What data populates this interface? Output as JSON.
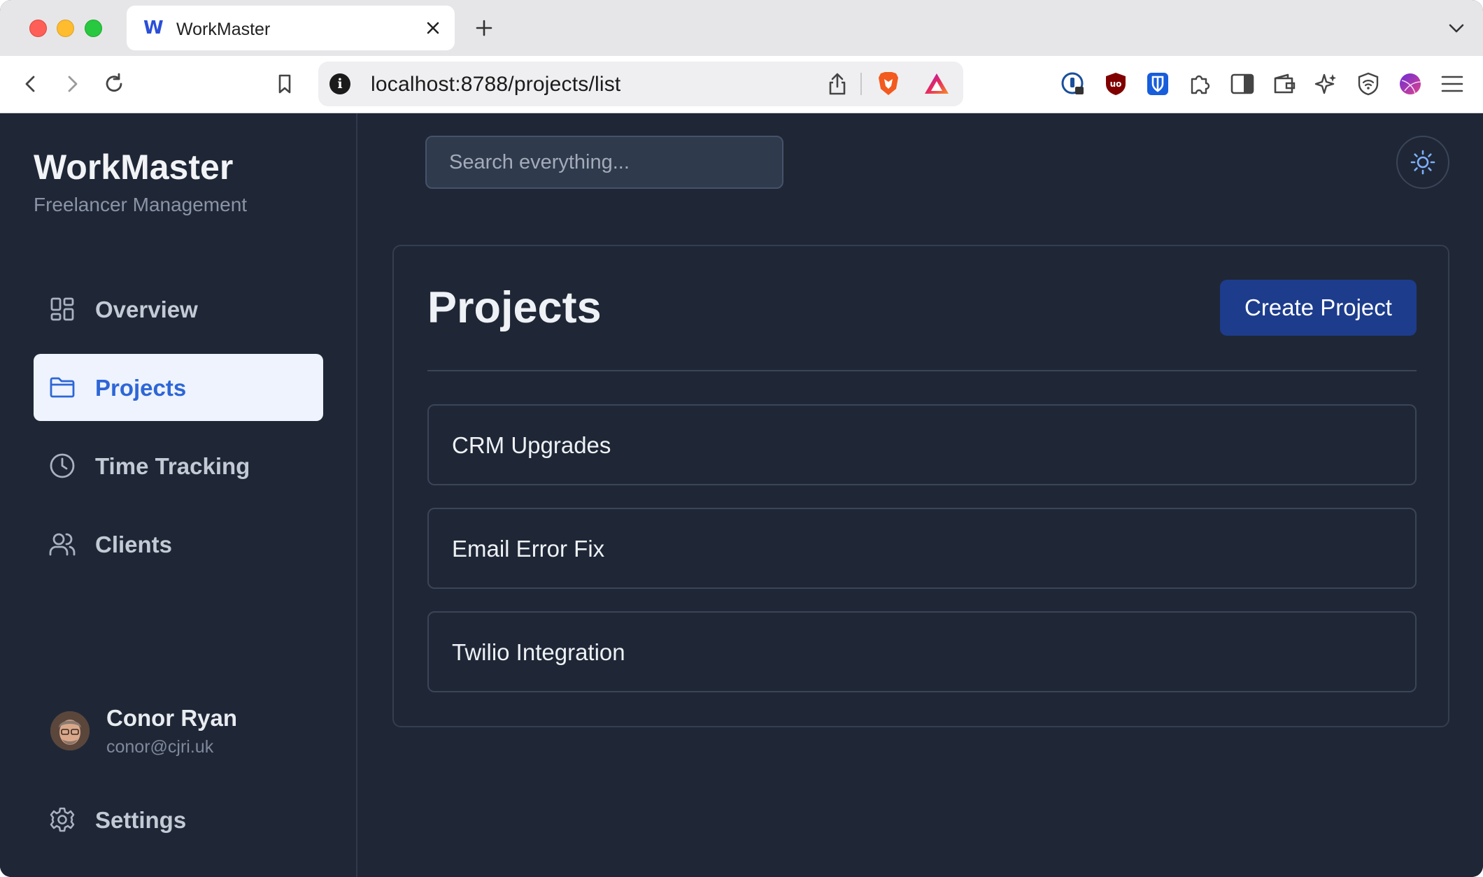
{
  "browser": {
    "tab": {
      "title": "WorkMaster",
      "favicon": "W"
    },
    "url": {
      "host": "localhost",
      "rest": ":8788/projects/list"
    },
    "icons": [
      "back-icon",
      "forward-icon",
      "reload-icon",
      "bookmark-icon",
      "info-icon",
      "share-icon",
      "brave-shields-icon",
      "brave-rewards-icon",
      "password-manager-icon",
      "ublock-icon",
      "bitwarden-icon",
      "extensions-icon",
      "sidebar-icon",
      "wallet-icon",
      "leo-ai-icon",
      "vpn-icon",
      "profile-icon",
      "menu-icon"
    ]
  },
  "sidebar": {
    "brand": "WorkMaster",
    "subtitle": "Freelancer Management",
    "nav": [
      {
        "label": "Overview",
        "icon": "grid-icon",
        "active": false
      },
      {
        "label": "Projects",
        "icon": "folder-icon",
        "active": true
      },
      {
        "label": "Time Tracking",
        "icon": "clock-icon",
        "active": false
      },
      {
        "label": "Clients",
        "icon": "users-icon",
        "active": false
      }
    ],
    "user": {
      "name": "Conor Ryan",
      "email": "conor@cjri.uk"
    },
    "settings_label": "Settings"
  },
  "header": {
    "search_placeholder": "Search everything..."
  },
  "main": {
    "title": "Projects",
    "create_label": "Create Project",
    "projects": [
      "CRM Upgrades",
      "Email Error Fix",
      "Twilio Integration"
    ]
  },
  "colors": {
    "background": "#1f2736",
    "active_nav_bg": "#eef3fd",
    "active_nav_text": "#2d66d6",
    "primary_button": "#1d3c8c"
  }
}
